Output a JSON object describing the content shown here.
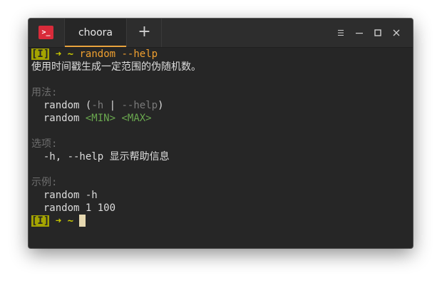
{
  "app": {
    "icon_glyph": ">_",
    "tab_title": "choora",
    "new_tab_glyph": "+",
    "accent_color": "#e8a33d"
  },
  "terminal": {
    "prompt": {
      "badge": "[I]",
      "arrow": "➜",
      "cwd": "~"
    },
    "command": "random --help",
    "description": "使用时间戳生成一定范围的伪随机数。",
    "usage": {
      "heading": "用法:",
      "line1": {
        "cmd": "random",
        "open": "(",
        "short": "-h",
        "sep": "|",
        "long": "--help",
        "close": ")"
      },
      "line2": {
        "cmd": "random",
        "arg1": "<MIN>",
        "arg2": "<MAX>"
      }
    },
    "options": {
      "heading": "选项:",
      "item": "-h, --help 显示帮助信息"
    },
    "examples": {
      "heading": "示例:",
      "items": [
        "random -h",
        "random 1 100"
      ]
    }
  }
}
